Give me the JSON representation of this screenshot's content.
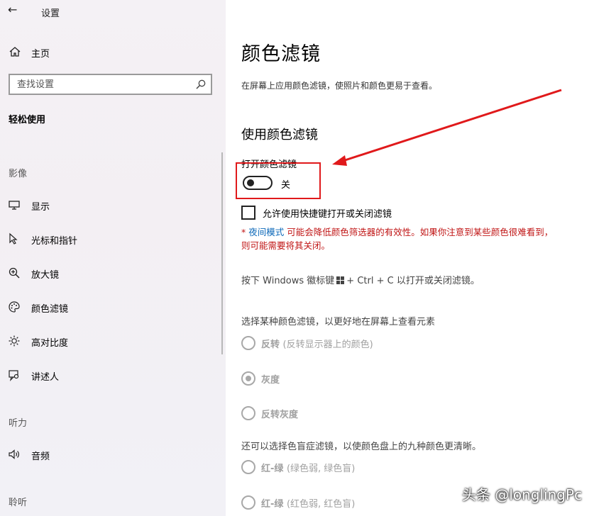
{
  "window": {
    "title": "设置"
  },
  "sidebar": {
    "home_label": "主页",
    "search_placeholder": "查找设置",
    "section_title": "轻松使用",
    "groups": [
      {
        "title": "影像"
      },
      {
        "title": "听力"
      },
      {
        "title": "聆听"
      }
    ],
    "items": [
      {
        "label": "显示",
        "icon": "monitor-icon"
      },
      {
        "label": "光标和指针",
        "icon": "pointer-icon"
      },
      {
        "label": "放大镜",
        "icon": "magnifier-icon"
      },
      {
        "label": "颜色滤镜",
        "icon": "palette-icon"
      },
      {
        "label": "高对比度",
        "icon": "sun-icon"
      },
      {
        "label": "讲述人",
        "icon": "narrator-icon"
      },
      {
        "label": "音频",
        "icon": "speaker-icon"
      }
    ]
  },
  "main": {
    "title": "颜色滤镜",
    "description": "在屏幕上应用颜色滤镜，使照片和颜色更易于查看。",
    "section_title": "使用颜色滤镜",
    "toggle": {
      "label": "打开颜色滤镜",
      "state": "关",
      "on": false
    },
    "shortcut_checkbox": {
      "label": "允许使用快捷键打开或关闭滤镜",
      "checked": false
    },
    "warning": {
      "prefix": "* ",
      "link": "夜间模式",
      "text": " 可能会降低颜色筛选器的有效性。如果你注意到某些颜色很难看到，则可能需要将其关闭。"
    },
    "shortcut_hint_before": "按下 Windows 徽标键",
    "shortcut_hint_after": "+ Ctrl + C 以打开或关闭滤镜。",
    "filter_group_title": "选择某种颜色滤镜，以更好地在屏幕上查看元素",
    "filters": [
      {
        "label": "反转",
        "hint": "(反转显示器上的颜色)",
        "selected": false
      },
      {
        "label": "灰度",
        "hint": "",
        "selected": true
      },
      {
        "label": "反转灰度",
        "hint": "",
        "selected": false
      }
    ],
    "colorblind_group_title": "还可以选择色盲症滤镜，以使颜色盘上的九种颜色更清晰。",
    "colorblind_filters": [
      {
        "label": "红-绿",
        "hint": "(绿色弱, 绿色盲)",
        "selected": false
      },
      {
        "label": "红-绿",
        "hint": "(红色弱, 红色盲)",
        "selected": false
      }
    ]
  },
  "watermark": "头条 @longlingPc",
  "colors": {
    "annotation": "#e0191b",
    "link": "#0a67b8",
    "warning": "#c01515"
  }
}
